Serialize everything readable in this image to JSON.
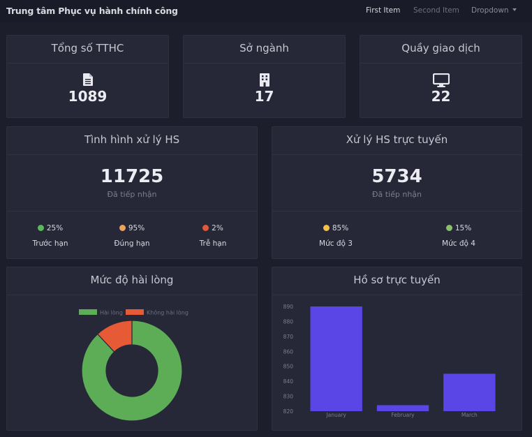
{
  "navbar": {
    "brand": "Trung tâm Phục vụ hành chính công",
    "items": [
      "First Item",
      "Second Item"
    ],
    "dropdown": "Dropdown"
  },
  "stats": [
    {
      "title": "Tổng số TTHC",
      "value": "1089",
      "icon": "file-icon"
    },
    {
      "title": "Sở ngành",
      "value": "17",
      "icon": "building-icon"
    },
    {
      "title": "Quầy giao dịch",
      "value": "22",
      "icon": "monitor-icon"
    }
  ],
  "processing": {
    "title": "Tình hình xử lý HS",
    "value": "11725",
    "subtitle": "Đã tiếp nhận",
    "items": [
      {
        "pct": "25%",
        "label": "Trước hạn",
        "color": "#5cb85c"
      },
      {
        "pct": "95%",
        "label": "Đúng hạn",
        "color": "#f0a05a"
      },
      {
        "pct": "2%",
        "label": "Trễ hạn",
        "color": "#e05a3a"
      }
    ]
  },
  "online": {
    "title": "Xử lý HS trực tuyến",
    "value": "5734",
    "subtitle": "Đã tiếp nhận",
    "items": [
      {
        "pct": "85%",
        "label": "Mức độ 3",
        "color": "#f5c04a"
      },
      {
        "pct": "15%",
        "label": "Mức độ 4",
        "color": "#8bc06a"
      }
    ]
  },
  "satisfaction": {
    "title": "Mức độ hài lòng"
  },
  "online_records": {
    "title": "Hồ sơ trực tuyến"
  },
  "chart_data": [
    {
      "type": "pie",
      "variant": "doughnut",
      "labels": [
        "Hài lòng",
        "Không hài lòng"
      ],
      "values": [
        88,
        12
      ],
      "colors": [
        "#5cad55",
        "#e65a36"
      ],
      "legend": "top"
    },
    {
      "type": "bar",
      "categories": [
        "January",
        "February",
        "March"
      ],
      "values": [
        890,
        824,
        845
      ],
      "ylim": [
        820,
        890
      ],
      "yticks": [
        820,
        830,
        840,
        850,
        860,
        870,
        880,
        890
      ],
      "color": "#5a46e6",
      "grid": false
    }
  ]
}
